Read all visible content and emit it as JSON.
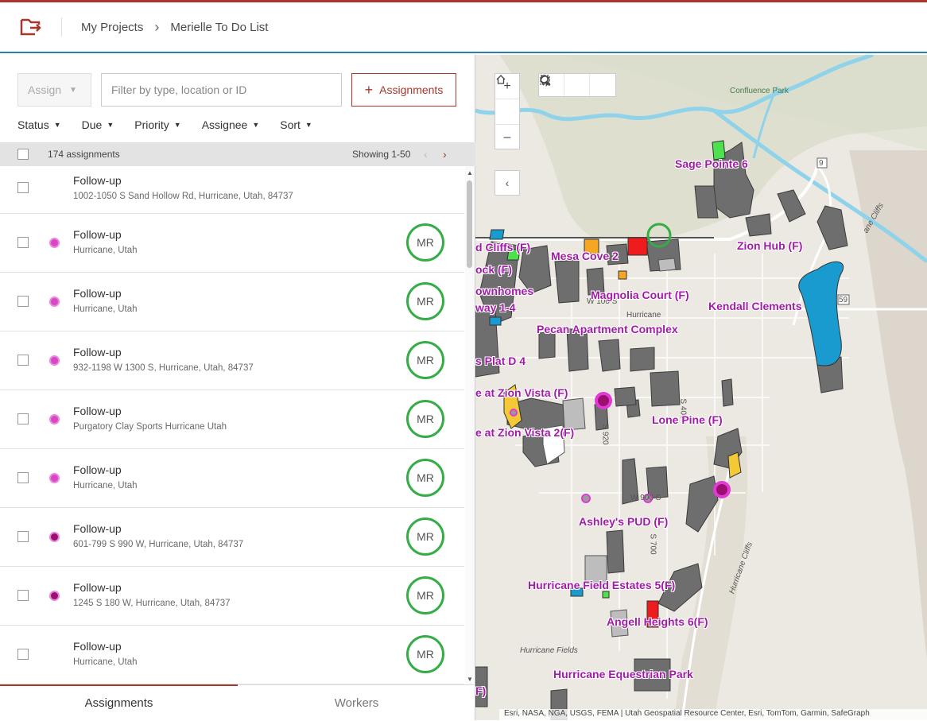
{
  "header": {
    "breadcrumb_projects": "My Projects",
    "breadcrumb_project": "Merielle To Do List"
  },
  "toolbar": {
    "assign_label": "Assign",
    "filter_placeholder": "Filter by type, location or ID",
    "assignments_button": "Assignments"
  },
  "filters": [
    "Status",
    "Due",
    "Priority",
    "Assignee",
    "Sort"
  ],
  "list_header": {
    "count": "174 assignments",
    "showing": "Showing 1-50"
  },
  "assignments": [
    {
      "title": "Follow-up",
      "location": "1002-1050 S Sand Hollow Rd, Hurricane, Utah, 84737",
      "dot": "none",
      "avatar": ""
    },
    {
      "title": "Follow-up",
      "location": "Hurricane, Utah",
      "dot": "#d946c4",
      "avatar": "MR"
    },
    {
      "title": "Follow-up",
      "location": "Hurricane, Utah",
      "dot": "#d946c4",
      "avatar": "MR"
    },
    {
      "title": "Follow-up",
      "location": "932-1198 W 1300 S, Hurricane, Utah, 84737",
      "dot": "#d946c4",
      "avatar": "MR"
    },
    {
      "title": "Follow-up",
      "location": "Purgatory Clay Sports Hurricane Utah",
      "dot": "#d946c4",
      "avatar": "MR"
    },
    {
      "title": "Follow-up",
      "location": "Hurricane, Utah",
      "dot": "#d946c4",
      "avatar": "MR"
    },
    {
      "title": "Follow-up",
      "location": "601-799 S 990 W, Hurricane, Utah, 84737",
      "dot": "#9c0f6e",
      "avatar": "MR"
    },
    {
      "title": "Follow-up",
      "location": "1245 S 180 W, Hurricane, Utah, 84737",
      "dot": "#9c0f6e",
      "avatar": "MR"
    },
    {
      "title": "Follow-up",
      "location": "Hurricane, Utah",
      "dot": "none",
      "avatar": "MR"
    }
  ],
  "tabs": {
    "assignments": "Assignments",
    "workers": "Workers"
  },
  "map": {
    "labels": [
      "Sage Pointe 6",
      "d Cliffs (F)",
      "Mesa Cove 2",
      "Zion Hub (F)",
      "ock (F)",
      "ownhomes",
      "Magnolia Court (F)",
      "way 1-4",
      "Kendall Clements",
      "Pecan Apartment Complex",
      "s Plat D 4",
      "e at Zion Vista (F)",
      "Lone Pine (F)",
      "e at Zion Vista 2(F)",
      "Ashley's PUD (F)",
      "Hurricane Field Estates 5(F)",
      "Angell Heights 6(F)",
      "Hurricane Equestrian Park",
      "F)"
    ],
    "place_labels": [
      "Confluence Park",
      "Hurricane",
      "Hurricane Cliffs",
      "Hurricane Fields",
      "ane Cliffs",
      "W 100 S",
      "W 900 S",
      "S 920",
      "S 400",
      "S 700",
      "9",
      "59"
    ],
    "attribution": "Esri, NASA, NGA, USGS, FEMA | Utah Geospatial Resource Center, Esri, TomTom, Garmin, SafeGraph"
  },
  "colors": {
    "brand": "#a8362a",
    "accent_blue": "#2a7fb0",
    "avatar_ring": "#35ac46",
    "parcel": "#6e6e6e",
    "label": "#a21aa8"
  }
}
